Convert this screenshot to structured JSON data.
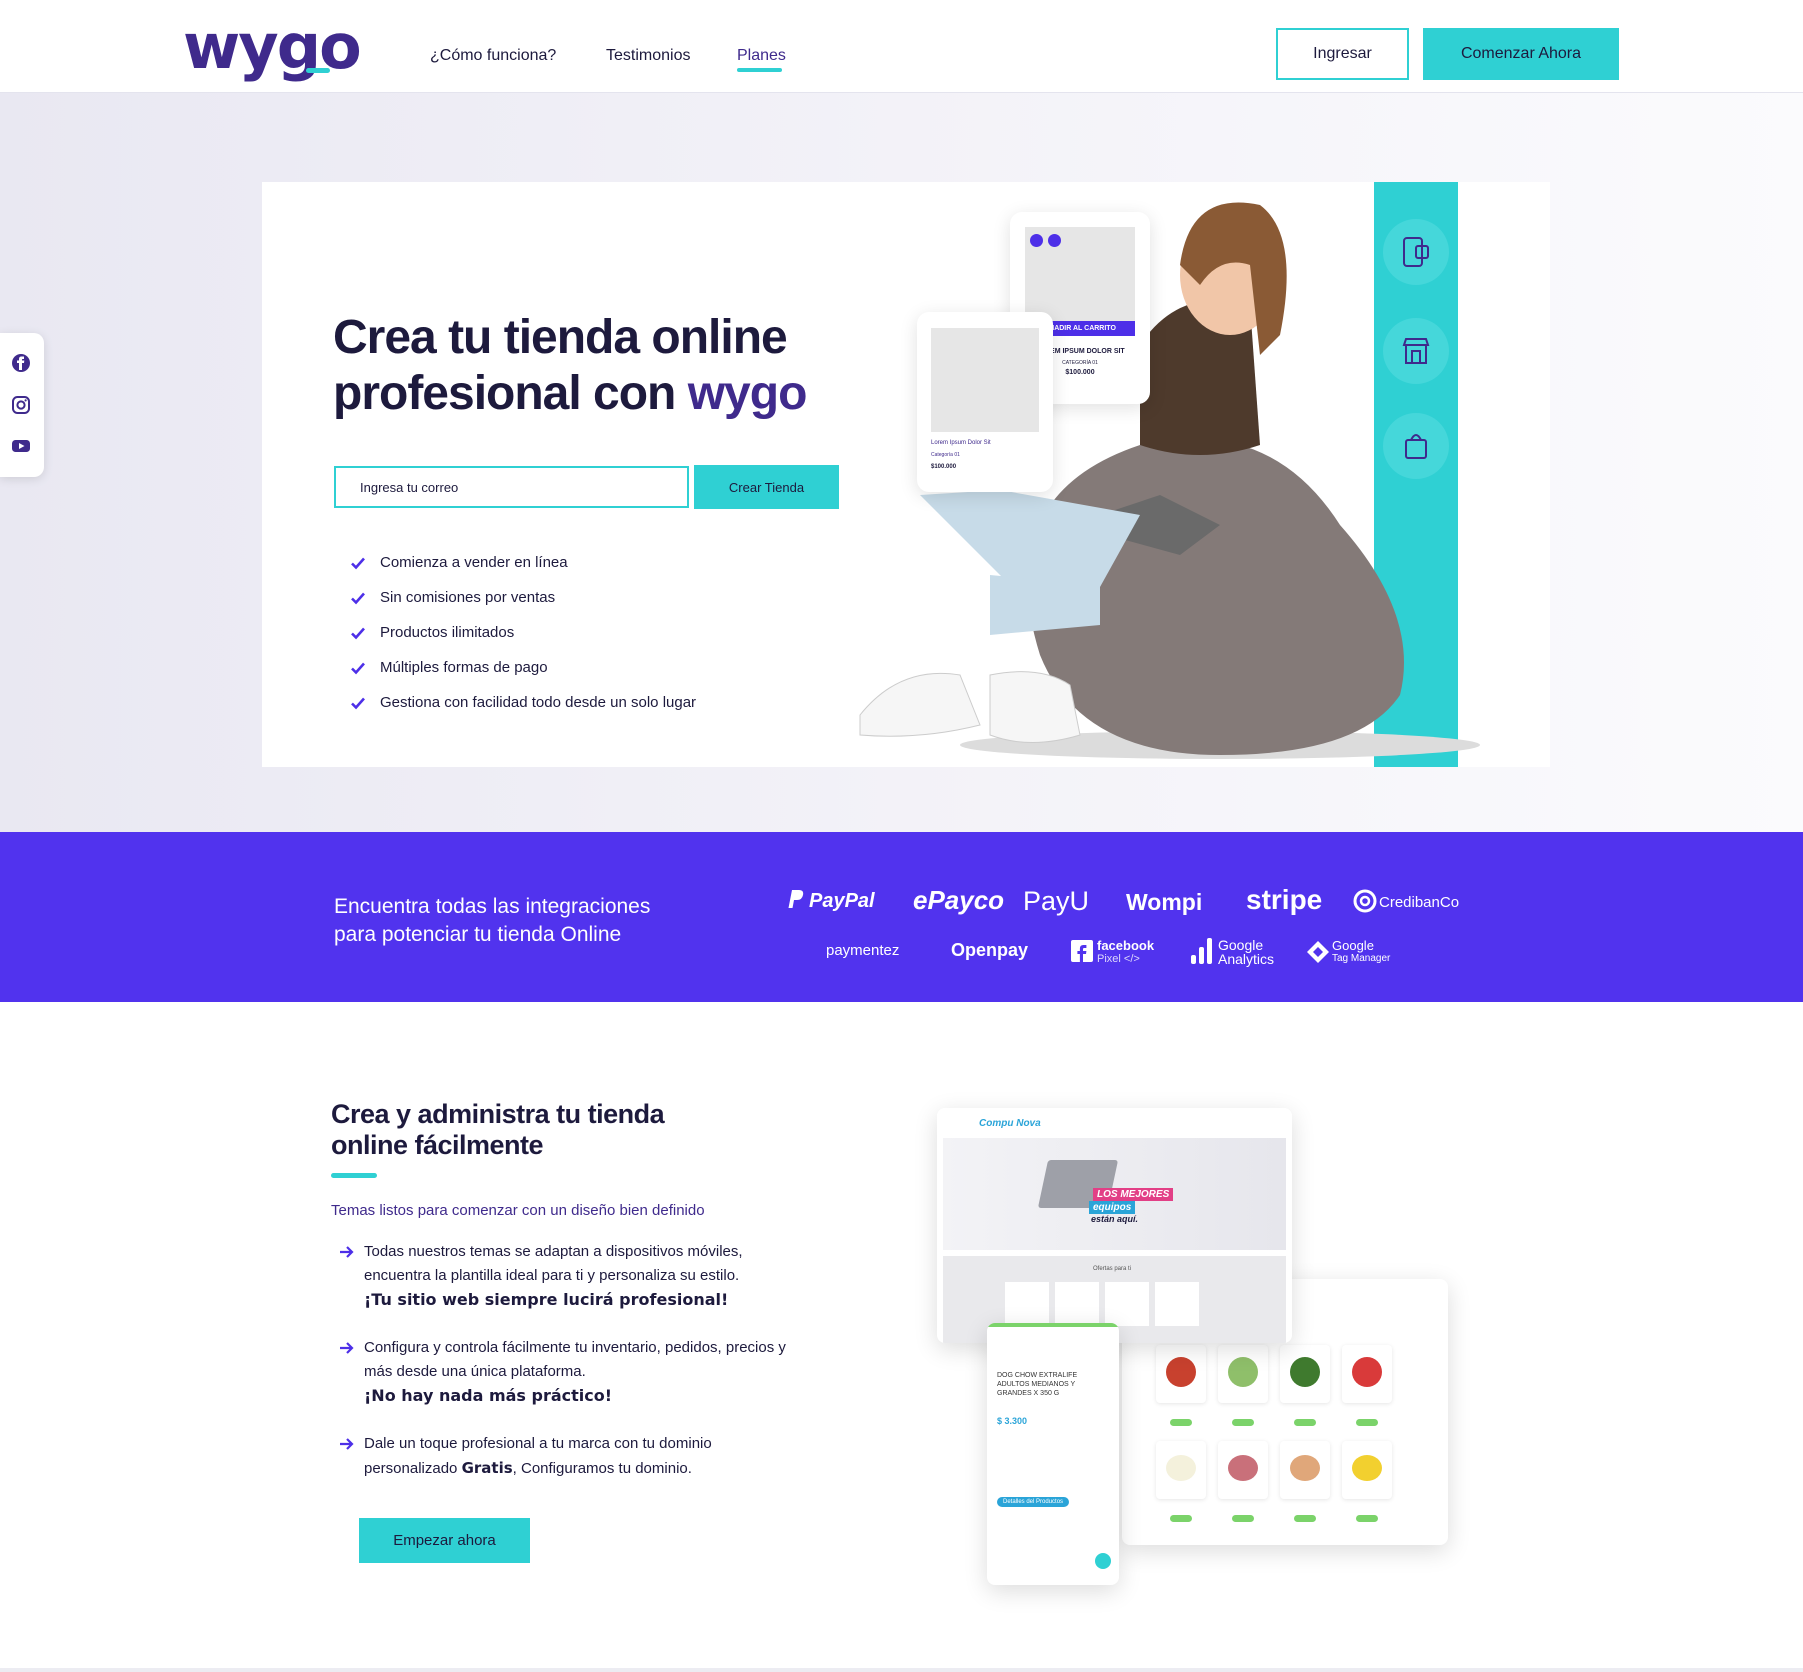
{
  "header": {
    "logo": "wygo",
    "nav": [
      "¿Cómo funciona?",
      "Testimonios",
      "Planes"
    ],
    "login_label": "Ingresar",
    "cta_label": "Comenzar Ahora"
  },
  "social": [
    "facebook-icon",
    "instagram-icon",
    "youtube-icon"
  ],
  "hero": {
    "title_line1": "Crea tu tienda online",
    "title_line2": "profesional con",
    "title_accent": "wygo",
    "email_placeholder": "Ingresa tu correo",
    "create_label": "Crear Tienda",
    "features": [
      "Comienza a vender en línea",
      "Sin comisiones por ventas",
      "Productos ilimitados",
      "Múltiples formas de pago",
      "Gestiona con facilidad todo desde un solo lugar"
    ],
    "card_a": {
      "cart_label": "AÑADIR AL CARRITO",
      "name": "LOREM IPSUM DOLOR SIT",
      "category": "CATEGORÍA 01",
      "price": "$100.000"
    },
    "card_b": {
      "name": "Lorem Ipsum Dolor Sit",
      "category": "Categoría 01",
      "price": "$100.000"
    }
  },
  "integrations": {
    "text_line1": "Encuentra todas las integraciones",
    "text_line2": "para potenciar tu tienda Online",
    "brands_row1": [
      "PayPal",
      "ePayco",
      "PayU",
      "Wompi",
      "stripe",
      "CredibanCo"
    ],
    "brands_row2": [
      "paymentez",
      "Openpay",
      "facebook",
      "Pixel </>",
      "Google",
      "Analytics",
      "Google",
      "Tag Manager"
    ]
  },
  "section2": {
    "title_line1": "Crea y administra tu tienda",
    "title_line2": "online fácilmente",
    "subtitle": "Temas listos para comenzar con un diseño bien definido",
    "bullets": [
      {
        "text": "Todas nuestros temas se adaptan a dispositivos móviles, encuentra la plantilla ideal para ti y personaliza su estilo.",
        "strong": "¡Tu sitio web siempre lucirá profesional!"
      },
      {
        "text": "Configura y controla fácilmente tu inventario, pedidos, precios y más desde una única plataforma.",
        "strong": "¡No hay nada más práctico!"
      },
      {
        "text_before": "Dale un toque profesional a tu marca con tu dominio personalizado ",
        "bold": "Gratis",
        "text_after": ", Configuramos tu dominio."
      }
    ],
    "button_label": "Empezar ahora"
  },
  "mockups": {
    "desktop_brand": "Compu Nova",
    "banner_line1": "LOS MEJORES",
    "banner_line2": "equipos",
    "banner_line3": "están aquí.",
    "offers_label": "Ofertas para ti",
    "mobile_product": "DOG CHOW EXTRALIFE ADULTOS MEDIANOS Y GRANDES X 350 G",
    "mobile_price": "$ 3.300",
    "mobile_details": "Detalles del Productos"
  },
  "colors": {
    "primary_purple": "#3f2a8c",
    "accent_teal": "#2fd0d3",
    "band_purple": "#5133ee",
    "text_dark": "#1d1a3d"
  }
}
